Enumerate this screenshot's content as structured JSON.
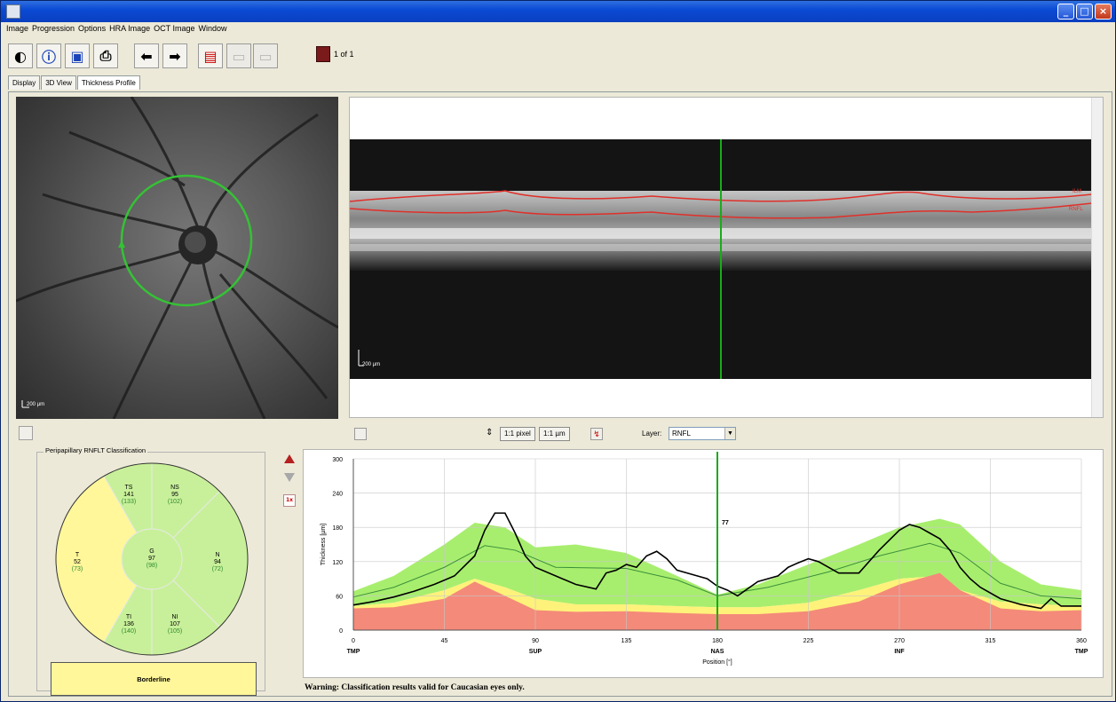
{
  "window": {
    "colors": {
      "titlebar": "#0b4bd4"
    }
  },
  "menu": [
    "Image",
    "Progression",
    "Options",
    "HRA Image",
    "OCT Image",
    "Window"
  ],
  "toolbar": {
    "icons": [
      "contrast-icon",
      "info-icon",
      "save-icon",
      "print-icon",
      "arrow-left-icon",
      "arrow-right-icon",
      "report-icon",
      "page-prev-icon",
      "page-next-icon"
    ],
    "page_info": "1 of 1"
  },
  "tabs": [
    {
      "label": "Display",
      "active": false
    },
    {
      "label": "3D View",
      "active": false
    },
    {
      "label": "Thickness Profile",
      "active": true
    }
  ],
  "fundus": {
    "scale": "200 µm"
  },
  "oct": {
    "scale": "200 µm",
    "layer_labels": {
      "ilm": "ILM",
      "rnfl": "RNFL"
    }
  },
  "controls": {
    "btn_pixel": "1:1 pixel",
    "btn_um": "1:1 µm",
    "layer_label": "Layer:",
    "layer_value": "RNFL",
    "zoom_label": "1x"
  },
  "classification": {
    "title": "Peripapillary RNFLT Classification",
    "sectors": {
      "TS": {
        "label": "TS",
        "value": "141",
        "ref": "(133)"
      },
      "NS": {
        "label": "NS",
        "value": "95",
        "ref": "(102)"
      },
      "T": {
        "label": "T",
        "value": "52",
        "ref": "(73)"
      },
      "G": {
        "label": "G",
        "value": "97",
        "ref": "(98)"
      },
      "N": {
        "label": "N",
        "value": "94",
        "ref": "(72)"
      },
      "TI": {
        "label": "TI",
        "value": "136",
        "ref": "(140)"
      },
      "NI": {
        "label": "NI",
        "value": "107",
        "ref": "(105)"
      }
    },
    "result": "Borderline",
    "colors": {
      "normal": "#c8f09a",
      "borderline": "#fff79a"
    }
  },
  "chart_data": {
    "type": "line",
    "ylabel": "Thickness [µm]",
    "xlabel": "Position [°]",
    "xlim": [
      0,
      360
    ],
    "ylim": [
      0,
      300
    ],
    "x_ticks": [
      0,
      45,
      90,
      135,
      180,
      225,
      270,
      315,
      360
    ],
    "y_ticks": [
      0,
      60,
      120,
      180,
      240,
      300
    ],
    "sector_labels": [
      {
        "x": 0,
        "label": "TMP"
      },
      {
        "x": 90,
        "label": "SUP"
      },
      {
        "x": 180,
        "label": "NAS"
      },
      {
        "x": 270,
        "label": "INF"
      },
      {
        "x": 360,
        "label": "TMP"
      }
    ],
    "cursor": {
      "x": 180,
      "label": "77"
    },
    "normal_band": {
      "x": [
        0,
        20,
        45,
        60,
        75,
        90,
        110,
        135,
        160,
        180,
        200,
        225,
        250,
        270,
        290,
        300,
        320,
        340,
        360
      ],
      "upper": [
        68,
        95,
        150,
        188,
        180,
        145,
        150,
        135,
        95,
        62,
        80,
        115,
        150,
        180,
        195,
        185,
        120,
        80,
        70
      ],
      "lower": [
        42,
        48,
        70,
        90,
        75,
        55,
        45,
        45,
        42,
        40,
        40,
        48,
        70,
        90,
        95,
        70,
        50,
        45,
        42
      ]
    },
    "borderline_low": {
      "x": [
        0,
        20,
        45,
        60,
        75,
        90,
        110,
        135,
        160,
        180,
        200,
        225,
        250,
        270,
        290,
        300,
        320,
        340,
        360
      ],
      "values": [
        38,
        42,
        60,
        80,
        65,
        45,
        38,
        38,
        34,
        32,
        33,
        40,
        60,
        80,
        85,
        60,
        42,
        38,
        38
      ]
    },
    "outside_low": {
      "x": [
        0,
        20,
        45,
        60,
        75,
        90,
        110,
        135,
        160,
        180,
        200,
        225,
        250,
        270,
        290,
        300,
        320,
        340,
        360
      ],
      "values": [
        38,
        40,
        55,
        85,
        60,
        35,
        32,
        33,
        30,
        28,
        28,
        33,
        50,
        80,
        100,
        70,
        38,
        33,
        35
      ]
    },
    "series": [
      {
        "name": "Mean normal",
        "x": [
          0,
          20,
          45,
          65,
          80,
          100,
          135,
          160,
          180,
          205,
          235,
          260,
          285,
          300,
          320,
          340,
          360
        ],
        "values": [
          58,
          75,
          110,
          148,
          140,
          110,
          108,
          88,
          60,
          75,
          102,
          130,
          152,
          135,
          82,
          60,
          55
        ]
      },
      {
        "name": "Measured RNFL",
        "x": [
          0,
          10,
          20,
          30,
          40,
          50,
          60,
          65,
          70,
          75,
          80,
          85,
          90,
          100,
          110,
          120,
          125,
          130,
          135,
          140,
          145,
          150,
          155,
          160,
          170,
          175,
          180,
          185,
          190,
          200,
          210,
          215,
          220,
          225,
          230,
          240,
          250,
          260,
          270,
          275,
          280,
          285,
          290,
          295,
          300,
          305,
          310,
          320,
          330,
          340,
          345,
          350,
          360
        ],
        "values": [
          44,
          50,
          58,
          68,
          80,
          95,
          130,
          175,
          205,
          205,
          170,
          130,
          110,
          95,
          80,
          72,
          100,
          105,
          115,
          110,
          130,
          138,
          125,
          105,
          95,
          90,
          77,
          70,
          60,
          85,
          95,
          110,
          118,
          125,
          120,
          100,
          100,
          140,
          175,
          185,
          180,
          170,
          160,
          140,
          110,
          90,
          75,
          55,
          45,
          38,
          55,
          42,
          42
        ]
      }
    ],
    "colors": {
      "green": "#a8ee6e",
      "yellow": "#fff27a",
      "red": "#f48a7a",
      "mean": "#3b8f3b",
      "measured": "#000000",
      "cursor": "#1aab1a"
    }
  },
  "warning": "Warning: Classification results valid for Caucasian eyes only."
}
